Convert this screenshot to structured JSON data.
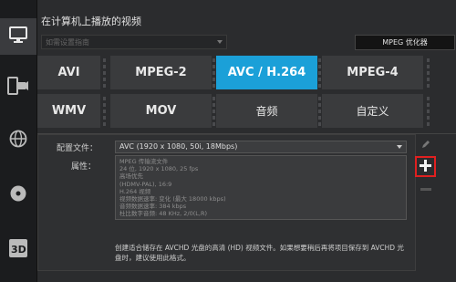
{
  "window": {
    "title": "在计算机上播放的视频"
  },
  "sidebar": {
    "items": [
      {
        "name": "computer",
        "icon": "monitor-icon",
        "active": true
      },
      {
        "name": "device",
        "icon": "device-camera-icon",
        "active": false
      },
      {
        "name": "web",
        "icon": "globe-icon",
        "active": false
      },
      {
        "name": "disc",
        "icon": "disc-icon",
        "active": false
      },
      {
        "name": "3d",
        "icon": "3d-icon",
        "active": false
      }
    ]
  },
  "device_select": {
    "value": "如需设置指南"
  },
  "toolbar": {
    "mpeg_optimizer_label": "MPEG 优化器"
  },
  "formats": {
    "items": [
      "AVI",
      "MPEG-2",
      "AVC / H.264",
      "MPEG-4",
      "WMV",
      "MOV",
      "音频",
      "自定义"
    ],
    "selected": "AVC / H.264"
  },
  "settings": {
    "profile_label": "配置文件：",
    "profile_value": "AVC (1920 x 1080, 50i, 18Mbps)",
    "properties_label": "属性：",
    "properties": [
      "MPEG 传输流文件",
      "24 位, 1920 x 1080, 25 fps",
      "高场优先",
      "(HDMV-PAL), 16:9",
      "H.264 视频",
      "视频数据速率: 变化 (最大 18000 kbps)",
      "音频数据速率: 384 kbps",
      "杜比数字音频: 48 KHz, 2/0(L,R)"
    ],
    "description": "创建适合储存在 AVCHD 光盘的高清 (HD) 视频文件。如果想要稍后再将项目保存到 AVCHD 光盘时，建议使用此格式。"
  },
  "colors": {
    "accent": "#1ba0d8",
    "highlight": "#e02020",
    "background": "#2b2c2e"
  }
}
